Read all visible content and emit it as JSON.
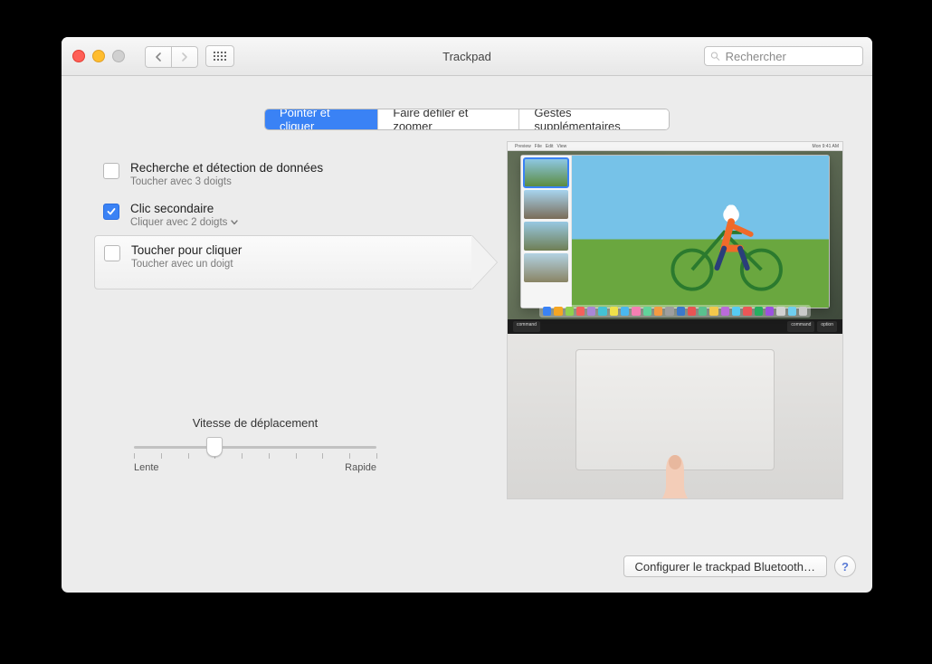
{
  "window": {
    "title": "Trackpad"
  },
  "search": {
    "placeholder": "Rechercher"
  },
  "tabs": [
    {
      "label": "Pointer et cliquer",
      "active": true
    },
    {
      "label": "Faire défiler et zoomer",
      "active": false
    },
    {
      "label": "Gestes supplémentaires",
      "active": false
    }
  ],
  "options": [
    {
      "title": "Recherche et détection de données",
      "subtitle": "Toucher avec 3 doigts",
      "checked": false,
      "has_dropdown": false
    },
    {
      "title": "Clic secondaire",
      "subtitle": "Cliquer avec 2 doigts",
      "checked": true,
      "has_dropdown": true
    },
    {
      "title": "Toucher pour cliquer",
      "subtitle": "Toucher avec un doigt",
      "checked": false,
      "has_dropdown": false,
      "highlighted": true
    }
  ],
  "slider": {
    "title": "Vitesse de déplacement",
    "min_label": "Lente",
    "max_label": "Rapide",
    "ticks": 10,
    "value": 3
  },
  "keyboard": {
    "left_keys": [
      "command"
    ],
    "right_keys": [
      "command",
      "option"
    ]
  },
  "dock_colors": [
    "#3a82f5",
    "#f5a623",
    "#8fd14f",
    "#f3615c",
    "#a987d6",
    "#44c2d3",
    "#f0e14a",
    "#4ab8ef",
    "#f57fb3",
    "#62d39a",
    "#f49b42",
    "#9e9e9e",
    "#3b79cc",
    "#e85454",
    "#5ac18e",
    "#f2c94c",
    "#bb6bd9",
    "#56ccf2",
    "#eb5757",
    "#27ae60",
    "#9b51e0",
    "#d1d1d1",
    "#6fcfef",
    "#c9c9c9"
  ],
  "bottom": {
    "bluetooth_button": "Configurer le trackpad Bluetooth…",
    "help": "?"
  }
}
